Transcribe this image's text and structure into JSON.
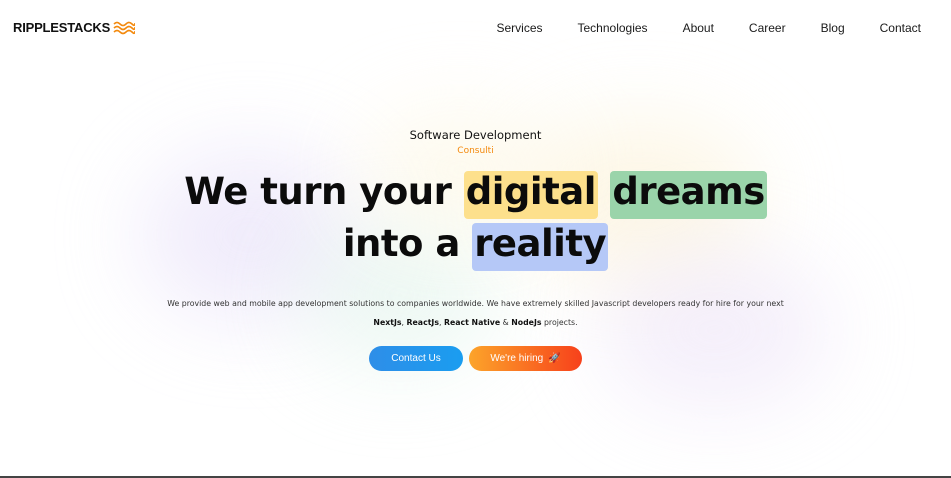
{
  "brand": {
    "name": "RIPPLESTACKS",
    "accent": "#f3890d"
  },
  "nav": {
    "items": [
      "Services",
      "Technologies",
      "About",
      "Career",
      "Blog",
      "Contact"
    ]
  },
  "hero": {
    "eyebrow": "Software Development",
    "eyebrow_sub": "Consulti",
    "headline": {
      "part1": "We turn your ",
      "word1": "digital",
      "word2": "dreams",
      "part2": "into a ",
      "word3": "reality"
    },
    "description": {
      "line1": "We provide web and mobile app development solutions to companies worldwide. We have extremely skilled Javascript developers ready for hire for your next",
      "tech1": "NextJs",
      "sep1": ",",
      "tech2": "ReactJs",
      "sep2": ",",
      "tech3": "React Native",
      "amp": "&",
      "tech4": "NodeJs",
      "tail": "projects."
    },
    "buttons": {
      "contact": "Contact Us",
      "hiring": "We're hiring",
      "hiring_icon": "rocket-icon"
    },
    "highlight_colors": {
      "yellow": "#fde08c",
      "green": "#9ad4aa",
      "blue": "#b5c8f7"
    }
  }
}
